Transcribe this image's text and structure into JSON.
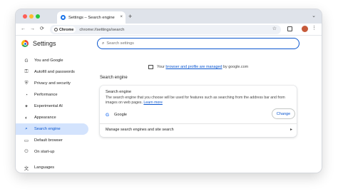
{
  "tab": {
    "title": "Settings – Search engine",
    "close": "×",
    "new_tab": "+",
    "search_tabs": "⌄"
  },
  "toolbar": {
    "back": "←",
    "forward": "→",
    "reload": "⟳",
    "chip_label": "Chrome",
    "url": "chrome://settings/search",
    "star": "☆",
    "menu": "⋮"
  },
  "settings": {
    "title": "Settings",
    "search_placeholder": "Search settings",
    "search_icon": "⌕"
  },
  "sidebar": {
    "items": [
      {
        "label": "You and Google",
        "icon": "G"
      },
      {
        "label": "Autofill and passwords",
        "icon": "⚿"
      },
      {
        "label": "Privacy and security",
        "icon": "⛨"
      },
      {
        "label": "Performance",
        "icon": "◔"
      },
      {
        "label": "Experimental AI",
        "icon": "✦"
      },
      {
        "label": "Appearance",
        "icon": "◐"
      },
      {
        "label": "Search engine",
        "icon": "⌕"
      },
      {
        "label": "Default browser",
        "icon": "▭"
      },
      {
        "label": "On start-up",
        "icon": "⏻"
      },
      {
        "label": "Languages",
        "icon": "文"
      }
    ],
    "active_index": 6
  },
  "managed": {
    "prefix": "Your ",
    "link": "browser and profile are managed",
    "suffix": " by google.com"
  },
  "section": {
    "title": "Search engine"
  },
  "card": {
    "title": "Search engine",
    "desc": "The search engine that you choose will be used for features such as searching from the address bar and from images on web pages.",
    "learn_more": "Learn more",
    "engine_icon": "G",
    "engine": "Google",
    "change_button": "Change",
    "manage_label": "Manage search engines and site search",
    "manage_arrow": "▸"
  },
  "colors": {
    "accent": "#0b57d0",
    "active_bg": "#d3e3fd"
  }
}
